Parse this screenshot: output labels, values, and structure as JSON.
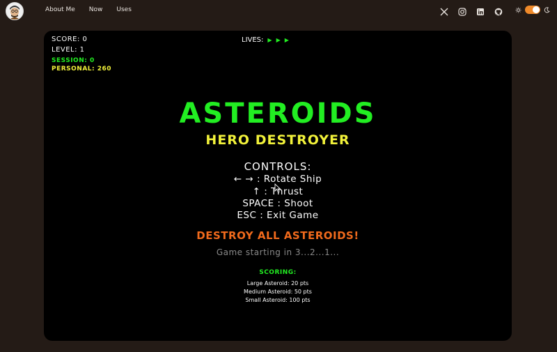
{
  "nav": {
    "items": [
      "About Me",
      "Now",
      "Uses"
    ]
  },
  "social": {
    "icons": [
      "x-icon",
      "instagram-icon",
      "linkedin-icon",
      "github-icon"
    ]
  },
  "theme": {
    "accent": "#f08a2a",
    "mode": "dark"
  },
  "hud": {
    "score": "SCORE: 0",
    "level": "LEVEL: 1",
    "session": "SESSION: 0",
    "personal": "PERSONAL: 260",
    "lives_label": "LIVES:",
    "lives_count": 3
  },
  "game": {
    "title": "ASTEROIDS",
    "subtitle": "HERO DESTROYER",
    "controls_heading": "CONTROLS:",
    "controls": [
      "← → : Rotate Ship",
      "↑ : Thrust",
      "SPACE : Shoot",
      "ESC : Exit Game"
    ],
    "objective": "DESTROY ALL ASTEROIDS!",
    "countdown": "Game starting in 3...2...1...",
    "scoring_heading": "SCORING:",
    "scoring": [
      "Large Asteroid: 20 pts",
      "Medium Asteroid: 50 pts",
      "Small Asteroid: 100 pts"
    ]
  },
  "colors": {
    "page_bg": "#241b16",
    "green": "#22ee22",
    "yellow": "#f2f23a",
    "orange": "#f06a1c",
    "gray": "#8a8a8a"
  }
}
